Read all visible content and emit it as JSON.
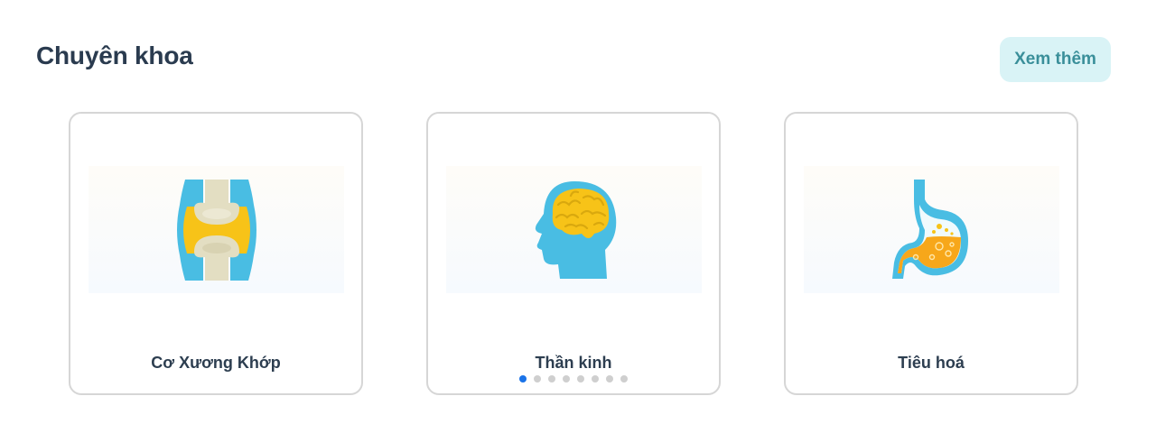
{
  "section": {
    "title": "Chuyên khoa",
    "more_label": "Xem thêm"
  },
  "cards": [
    {
      "label": "Cơ Xương Khớp",
      "icon": "joint-icon"
    },
    {
      "label": "Thần kinh",
      "icon": "brain-head-icon"
    },
    {
      "label": "Tiêu hoá",
      "icon": "stomach-icon"
    }
  ],
  "carousel": {
    "page_count": 8,
    "active_index": 0
  },
  "colors": {
    "title": "#2a3b4f",
    "button_bg": "#d9f3f6",
    "button_text": "#3a8f9a",
    "illustration_blue": "#49bde3",
    "illustration_yellow": "#f7c318",
    "dot_active": "#1a73e8",
    "dot_inactive": "#cfcfcf"
  }
}
